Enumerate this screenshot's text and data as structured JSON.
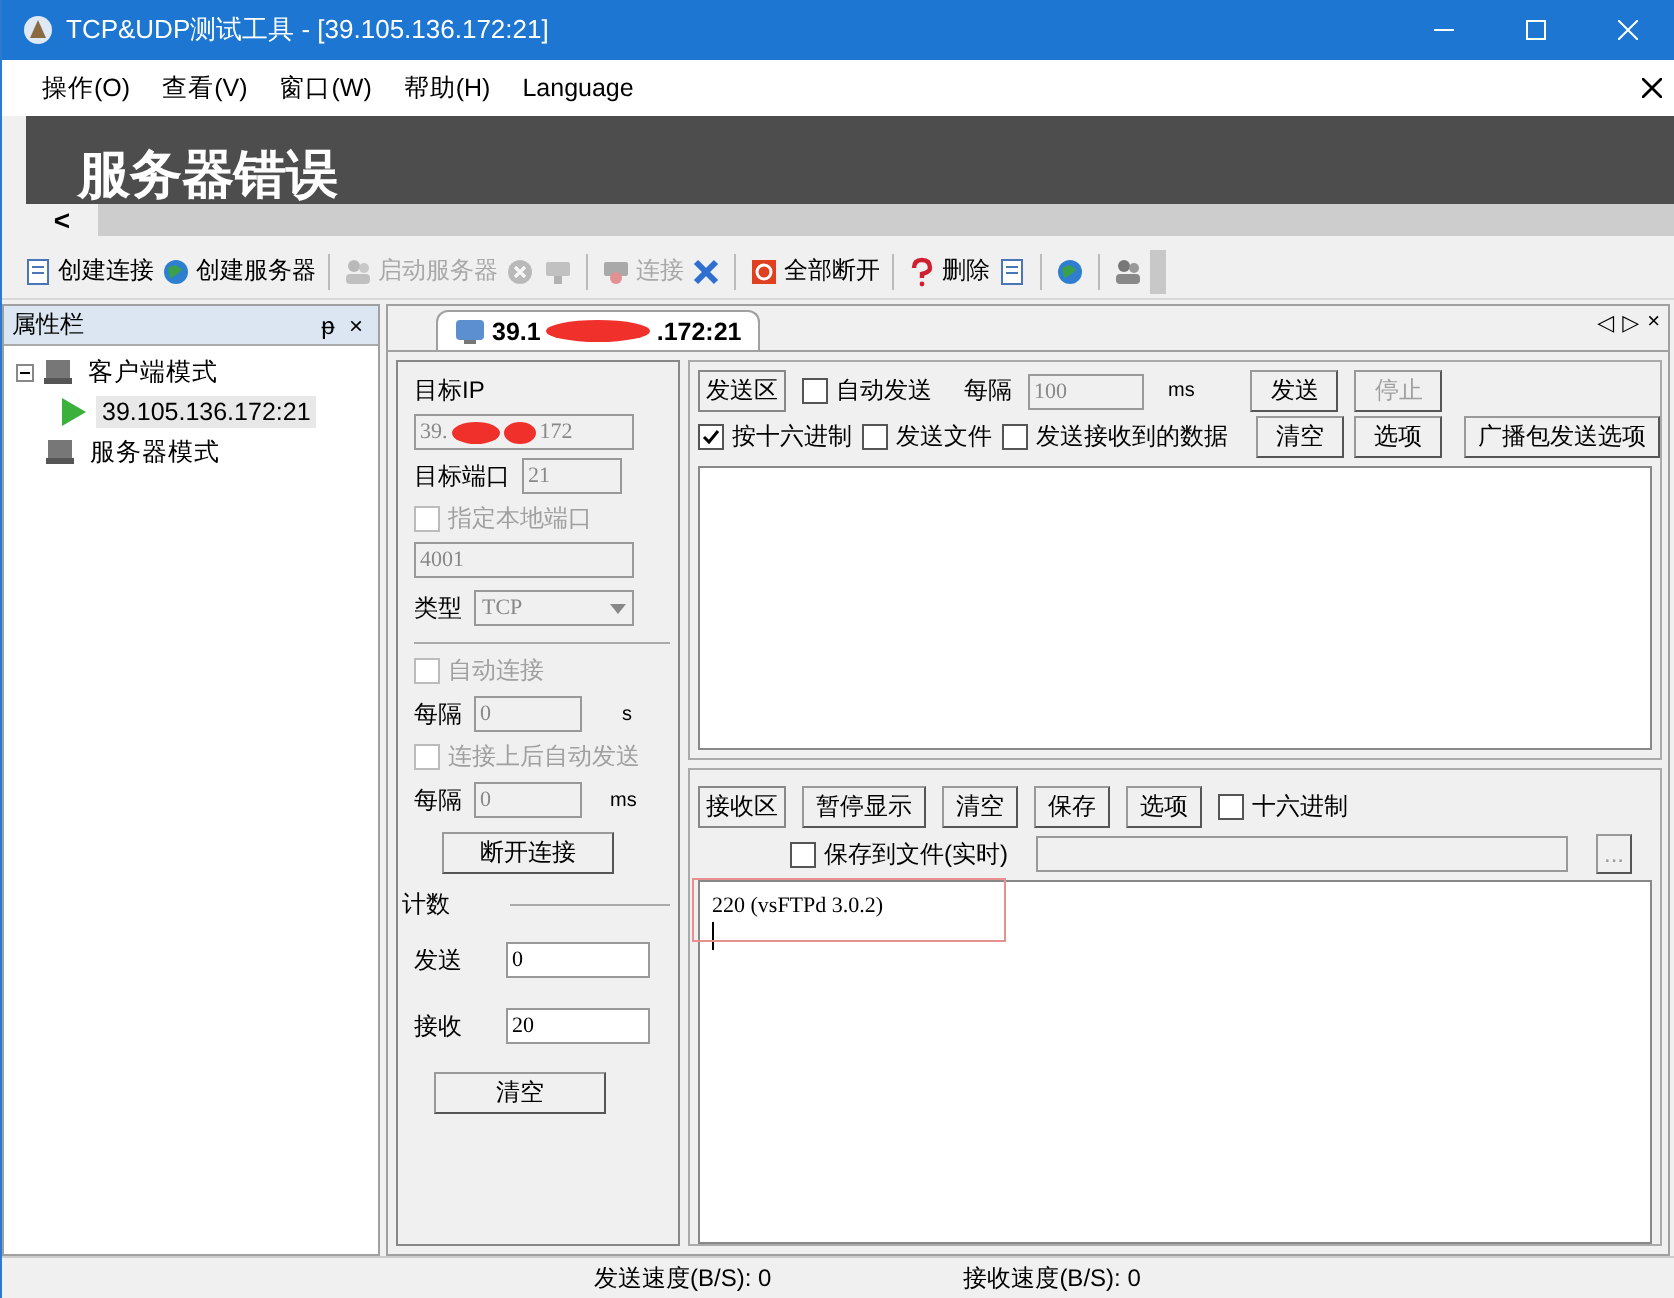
{
  "window": {
    "title": "TCP&UDP测试工具 - [39.105.136.172:21]"
  },
  "menu": [
    "操作(O)",
    "查看(V)",
    "窗口(W)",
    "帮助(H)",
    "Language"
  ],
  "banner": {
    "text": "服务器错误",
    "scroll_arrow": "<"
  },
  "toolbar": [
    {
      "kind": "button",
      "label": "创建连接",
      "disabled": false
    },
    {
      "kind": "button",
      "label": "创建服务器",
      "disabled": false
    },
    {
      "kind": "separator"
    },
    {
      "kind": "button",
      "label": "启动服务器",
      "disabled": true
    },
    {
      "kind": "icon",
      "disabled": true
    },
    {
      "kind": "icon",
      "disabled": true
    },
    {
      "kind": "separator"
    },
    {
      "kind": "button",
      "label": "连接",
      "disabled": true
    },
    {
      "kind": "icon",
      "disabled": false
    },
    {
      "kind": "separator"
    },
    {
      "kind": "button",
      "label": "全部断开",
      "disabled": false
    },
    {
      "kind": "separator"
    },
    {
      "kind": "button",
      "label": "删除",
      "disabled": false
    },
    {
      "kind": "icon",
      "disabled": false
    },
    {
      "kind": "separator"
    },
    {
      "kind": "icon",
      "disabled": false
    },
    {
      "kind": "separator"
    },
    {
      "kind": "icon",
      "disabled": false
    }
  ],
  "sidebar": {
    "title": "属性栏",
    "pin": "ᵽ",
    "close": "×",
    "tree": [
      {
        "label": "客户端模式",
        "expanded": true,
        "children": [
          {
            "label": "39.105.136.172:21",
            "selected": true
          }
        ]
      },
      {
        "label": "服务器模式"
      }
    ]
  },
  "tab": {
    "label_start": "39.1",
    "label_end": ".172:21",
    "nav": [
      "◁",
      "▷",
      "×"
    ]
  },
  "settings": {
    "target_ip_label": "目标IP",
    "target_ip_start": "39.",
    "target_ip_end": "172",
    "target_port_label": "目标端口",
    "target_port": "21",
    "local_port": {
      "label": "指定本地端口",
      "checked": false,
      "disabled": true
    },
    "local_port_value": "4001",
    "type_label": "类型",
    "type_value": "TCP",
    "auto_connect": {
      "label": "自动连接",
      "checked": false,
      "disabled": true
    },
    "interval1_label": "每隔",
    "interval1": "0",
    "interval1_unit": "s",
    "auto_send": {
      "label": "连接上后自动发送",
      "checked": false,
      "disabled": true
    },
    "interval2_label": "每隔",
    "interval2": "0",
    "interval2_unit": "ms",
    "disconnect_button": "断开连接",
    "count_label": "计数",
    "sent_label": "发送",
    "sent": "0",
    "received_label": "接收",
    "received": "20",
    "clear_button": "清空"
  },
  "send": {
    "area_label": "发送区",
    "auto_send": {
      "label": "自动发送",
      "checked": false
    },
    "interval_label": "每隔",
    "interval": "100",
    "interval_unit": "ms",
    "buttons_row1": [
      {
        "label": "发送",
        "disabled": false
      },
      {
        "label": "停止",
        "disabled": true
      }
    ],
    "options": [
      {
        "label": "按十六进制",
        "checked": true
      },
      {
        "label": "发送文件",
        "checked": false
      },
      {
        "label": "发送接收到的数据",
        "checked": false
      }
    ],
    "buttons_row2": [
      {
        "label": "清空",
        "disabled": false
      },
      {
        "label": "选项",
        "disabled": false
      }
    ],
    "broadcast_button": "广播包发送选项"
  },
  "receive": {
    "area_label": "接收区",
    "buttons": [
      "暂停显示",
      "清空",
      "保存",
      "选项"
    ],
    "hex": {
      "label": "十六进制",
      "checked": false
    },
    "save_to_file": {
      "label": "保存到文件(实时)",
      "checked": false
    },
    "browse_button": "...",
    "text": "220 (vsFTPd 3.0.2)"
  },
  "status_bar": {
    "send_speed": "发送速度(B/S): 0",
    "receive_speed": "接收速度(B/S): 0"
  }
}
